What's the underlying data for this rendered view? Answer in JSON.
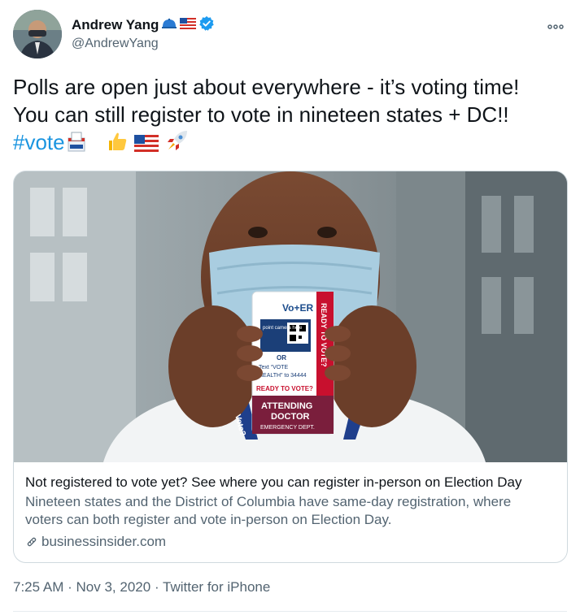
{
  "user": {
    "display_name": "Andrew Yang",
    "handle": "@AndrewYang",
    "name_emojis": [
      "cap-emoji",
      "us-flag-emoji"
    ],
    "verified": true
  },
  "tweet": {
    "text_line1": "Polls are open just about everywhere - it’s voting time!",
    "text_line2": "You can still register to vote in nineteen states + DC!!",
    "hashtag": "#vote",
    "trailing_emojis": [
      "ballot-box-emoji",
      "thumbs-up-emoji",
      "us-flag-emoji",
      "rocket-emoji"
    ]
  },
  "card": {
    "title": "Not registered to vote yet? See where you can register in-person on Election Day",
    "description_line1": "Nineteen states and the District of Columbia have same-day registration, where",
    "description_line2": "voters can both register and vote in-person on Election Day.",
    "domain": "businessinsider.com",
    "image": {
      "badge_brand": "Vo+ER",
      "badge_side_text": "READY TO VOTE?",
      "badge_scan_text": "point camera here",
      "badge_or": "OR",
      "badge_text_line1": "Text “VOTE",
      "badge_text_line2": "HEALTH” to 34444",
      "badge_ready": "READY TO VOTE?",
      "badge_role_line1": "ATTENDING",
      "badge_role_line2": "DOCTOR",
      "badge_dept": "EMERGENCY DEPT.",
      "lanyard_text": "Vote?"
    }
  },
  "meta": {
    "time": "7:25 AM",
    "date": "Nov 3, 2020",
    "source": "Twitter for iPhone",
    "separator": "·"
  },
  "colors": {
    "text": "#0f1419",
    "secondary": "#536471",
    "link": "#1b95e0",
    "verified": "#1d9bf0",
    "border": "#cfd9de"
  }
}
